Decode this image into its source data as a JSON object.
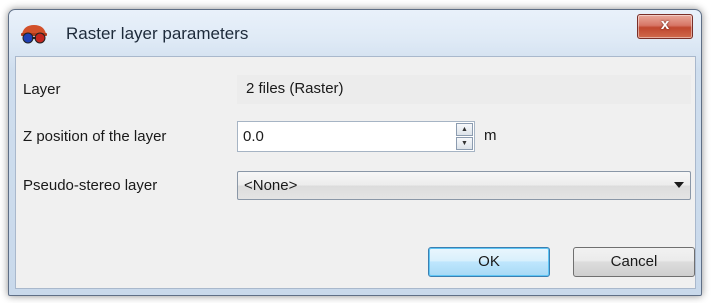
{
  "window": {
    "title": "Raster layer parameters",
    "close_glyph": "x"
  },
  "form": {
    "layer_label": "Layer",
    "layer_value": "2 files (Raster)",
    "z_label": "Z position of the layer",
    "z_value": "0.0",
    "z_unit": "m",
    "stereo_label": "Pseudo-stereo layer",
    "stereo_value": "<None>"
  },
  "buttons": {
    "ok_label": "OK",
    "cancel_label": "Cancel"
  },
  "icons": {
    "app": "stereo-glasses-icon",
    "close": "close-icon",
    "spin_up": "spin-up-icon",
    "spin_down": "spin-down-icon",
    "dropdown": "chevron-down-icon"
  },
  "colors": {
    "title_bar": "#dfeaf6",
    "close_button": "#c0472f",
    "client_background": "#f0f0f0",
    "default_button_border": "#3c7fb1"
  }
}
